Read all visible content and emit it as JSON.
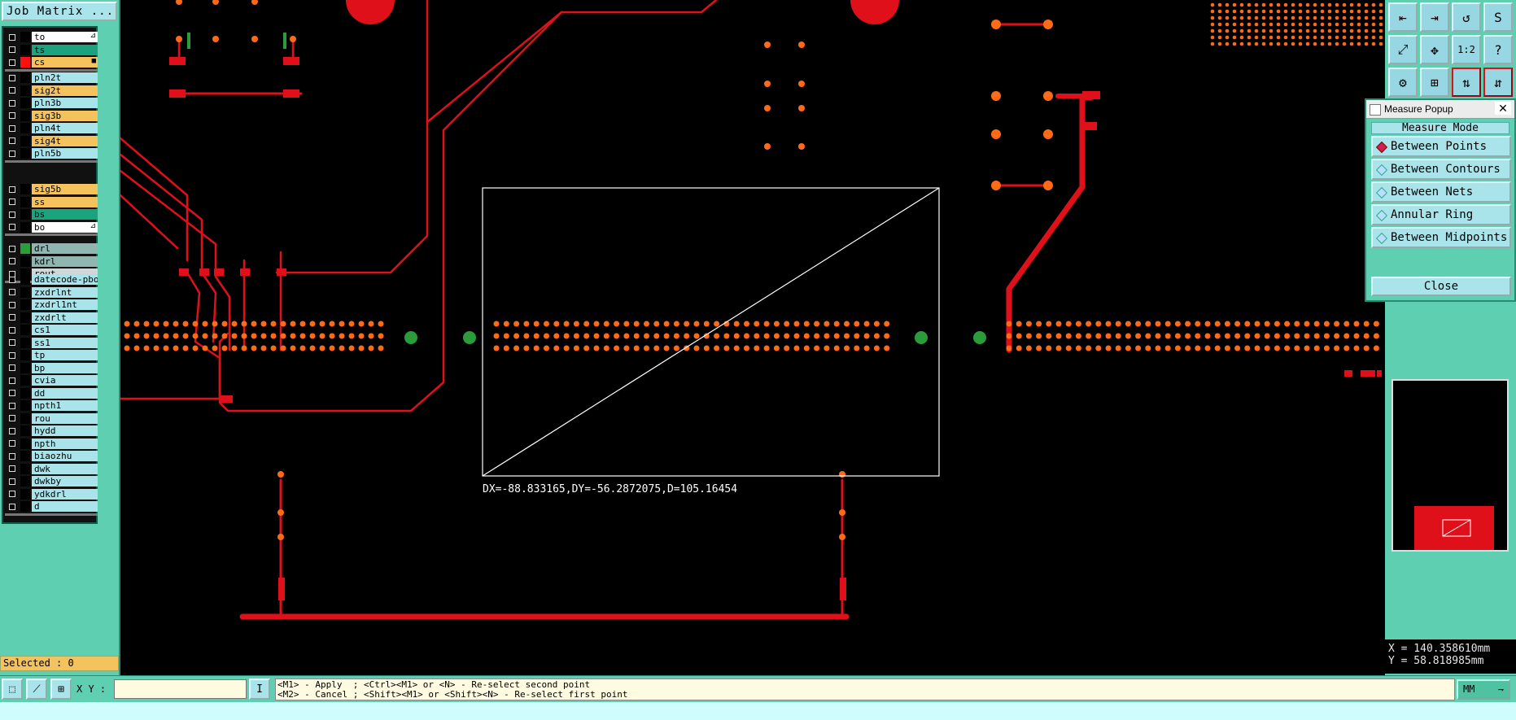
{
  "left_panel": {
    "job_matrix_label": "Job Matrix ...",
    "selected_label": "Selected : 0",
    "layer_groups": [
      [
        {
          "name": "to",
          "color": "#ffffff",
          "swatch": "#000000",
          "flag": "⊿"
        },
        {
          "name": "ts",
          "color": "#1aa37e",
          "swatch": "#000000",
          "flag": ""
        },
        {
          "name": "cs",
          "color": "#f4c35e",
          "swatch": "#ff1010",
          "flag": "■"
        }
      ],
      [
        {
          "name": "pln2t",
          "color": "#a8e4ea",
          "swatch": "#000000",
          "flag": ""
        },
        {
          "name": "sig2t",
          "color": "#f4c35e",
          "swatch": "#000000",
          "flag": ""
        },
        {
          "name": "pln3b",
          "color": "#a8e4ea",
          "swatch": "#000000",
          "flag": ""
        },
        {
          "name": "sig3b",
          "color": "#f4c35e",
          "swatch": "#000000",
          "flag": ""
        },
        {
          "name": "pln4t",
          "color": "#a8e4ea",
          "swatch": "#000000",
          "flag": ""
        },
        {
          "name": "sig4t",
          "color": "#f4c35e",
          "swatch": "#000000",
          "flag": ""
        },
        {
          "name": "pln5b",
          "color": "#a8e4ea",
          "swatch": "#000000",
          "flag": ""
        }
      ],
      [
        {
          "name": "sig5b",
          "color": "#f4c35e",
          "swatch": "#000000",
          "flag": ""
        },
        {
          "name": "ss",
          "color": "#f4c35e",
          "swatch": "#000000",
          "flag": ""
        },
        {
          "name": "bs",
          "color": "#1aa37e",
          "swatch": "#000000",
          "flag": ""
        },
        {
          "name": "bo",
          "color": "#ffffff",
          "swatch": "#000000",
          "flag": "⊿"
        }
      ],
      [
        {
          "name": "drl",
          "color": "#8fb6b0",
          "swatch": "#2a9d3a",
          "flag": ""
        },
        {
          "name": "kdrl",
          "color": "#8fb6b0",
          "swatch": "#000000",
          "flag": ""
        },
        {
          "name": "rout",
          "color": "#cfd8d8",
          "swatch": "#000000",
          "flag": ""
        }
      ],
      [
        {
          "name": "datecode-pbo",
          "color": "#a8e4ea",
          "swatch": "#000000",
          "flag": ""
        },
        {
          "name": "zxdrlnt",
          "color": "#a8e4ea",
          "swatch": "#000000",
          "flag": ""
        },
        {
          "name": "zxdrl1nt",
          "color": "#a8e4ea",
          "swatch": "#000000",
          "flag": ""
        },
        {
          "name": "zxdrlt",
          "color": "#a8e4ea",
          "swatch": "#000000",
          "flag": ""
        },
        {
          "name": "cs1",
          "color": "#a8e4ea",
          "swatch": "#000000",
          "flag": ""
        },
        {
          "name": "ss1",
          "color": "#a8e4ea",
          "swatch": "#000000",
          "flag": ""
        },
        {
          "name": "tp",
          "color": "#a8e4ea",
          "swatch": "#000000",
          "flag": ""
        },
        {
          "name": "bp",
          "color": "#a8e4ea",
          "swatch": "#000000",
          "flag": ""
        },
        {
          "name": "cvia",
          "color": "#a8e4ea",
          "swatch": "#000000",
          "flag": ""
        },
        {
          "name": "dd",
          "color": "#a8e4ea",
          "swatch": "#000000",
          "flag": ""
        },
        {
          "name": "npth1",
          "color": "#a8e4ea",
          "swatch": "#000000",
          "flag": ""
        },
        {
          "name": "rou",
          "color": "#a8e4ea",
          "swatch": "#000000",
          "flag": ""
        },
        {
          "name": "hydd",
          "color": "#a8e4ea",
          "swatch": "#000000",
          "flag": ""
        },
        {
          "name": "npth",
          "color": "#a8e4ea",
          "swatch": "#000000",
          "flag": ""
        },
        {
          "name": "biaozhu",
          "color": "#a8e4ea",
          "swatch": "#000000",
          "flag": ""
        },
        {
          "name": "dwk",
          "color": "#a8e4ea",
          "swatch": "#000000",
          "flag": ""
        },
        {
          "name": "dwkby",
          "color": "#a8e4ea",
          "swatch": "#000000",
          "flag": ""
        },
        {
          "name": "ydkdrl",
          "color": "#a8e4ea",
          "swatch": "#000000",
          "flag": ""
        },
        {
          "name": "d",
          "color": "#a8e4ea",
          "swatch": "#000000",
          "flag": ""
        }
      ]
    ]
  },
  "canvas": {
    "measure_readout": "DX=-88.833165,DY=-56.2872075,D=105.16454",
    "trace_color": "#e0101a",
    "pad_color": "#ff6a18",
    "drill_color": "#2a9d3a",
    "measure_color": "#ffffff"
  },
  "toolbar": {
    "icons": [
      {
        "name": "zoom-home-icon",
        "glyph": "⇤"
      },
      {
        "name": "zoom-back-icon",
        "glyph": "⇥"
      },
      {
        "name": "zoom-undo-icon",
        "glyph": "↺"
      },
      {
        "name": "snap-icon",
        "glyph": "S"
      },
      {
        "name": "zoom-fit-icon",
        "glyph": "⤢"
      },
      {
        "name": "pan-icon",
        "glyph": "✥"
      },
      {
        "name": "scale-1-2-icon",
        "glyph": "1:2"
      },
      {
        "name": "help-icon",
        "glyph": "?"
      },
      {
        "name": "wrench-icon",
        "glyph": "⚙"
      },
      {
        "name": "grid-icon",
        "glyph": "⊞"
      },
      {
        "name": "layer-toggle-icon",
        "glyph": "⇅"
      },
      {
        "name": "layer-swap-icon",
        "glyph": "⇵"
      }
    ]
  },
  "measure_popup": {
    "title": "Measure Popup",
    "close_x": "✕",
    "mode_label": "Measure Mode",
    "options": [
      {
        "label": "Between Points",
        "selected": true
      },
      {
        "label": "Between Contours",
        "selected": false
      },
      {
        "label": "Between Nets",
        "selected": false
      },
      {
        "label": "Annular Ring",
        "selected": false
      },
      {
        "label": "Between Midpoints",
        "selected": false
      }
    ],
    "close_label": "Close"
  },
  "coords": {
    "x": "X = 140.358610mm",
    "y": "Y = 58.818985mm"
  },
  "bottom_bar": {
    "xy_label": "X Y :",
    "xy_value": "",
    "hint_line1": "<M1> - Apply  ; <Ctrl><M1> or <N> - Re-select second point",
    "hint_line2": "<M2> - Cancel ; <Shift><M1> or <Shift><N> - Re-select first point",
    "unit": "MM",
    "unit_arrow": "⇁"
  }
}
